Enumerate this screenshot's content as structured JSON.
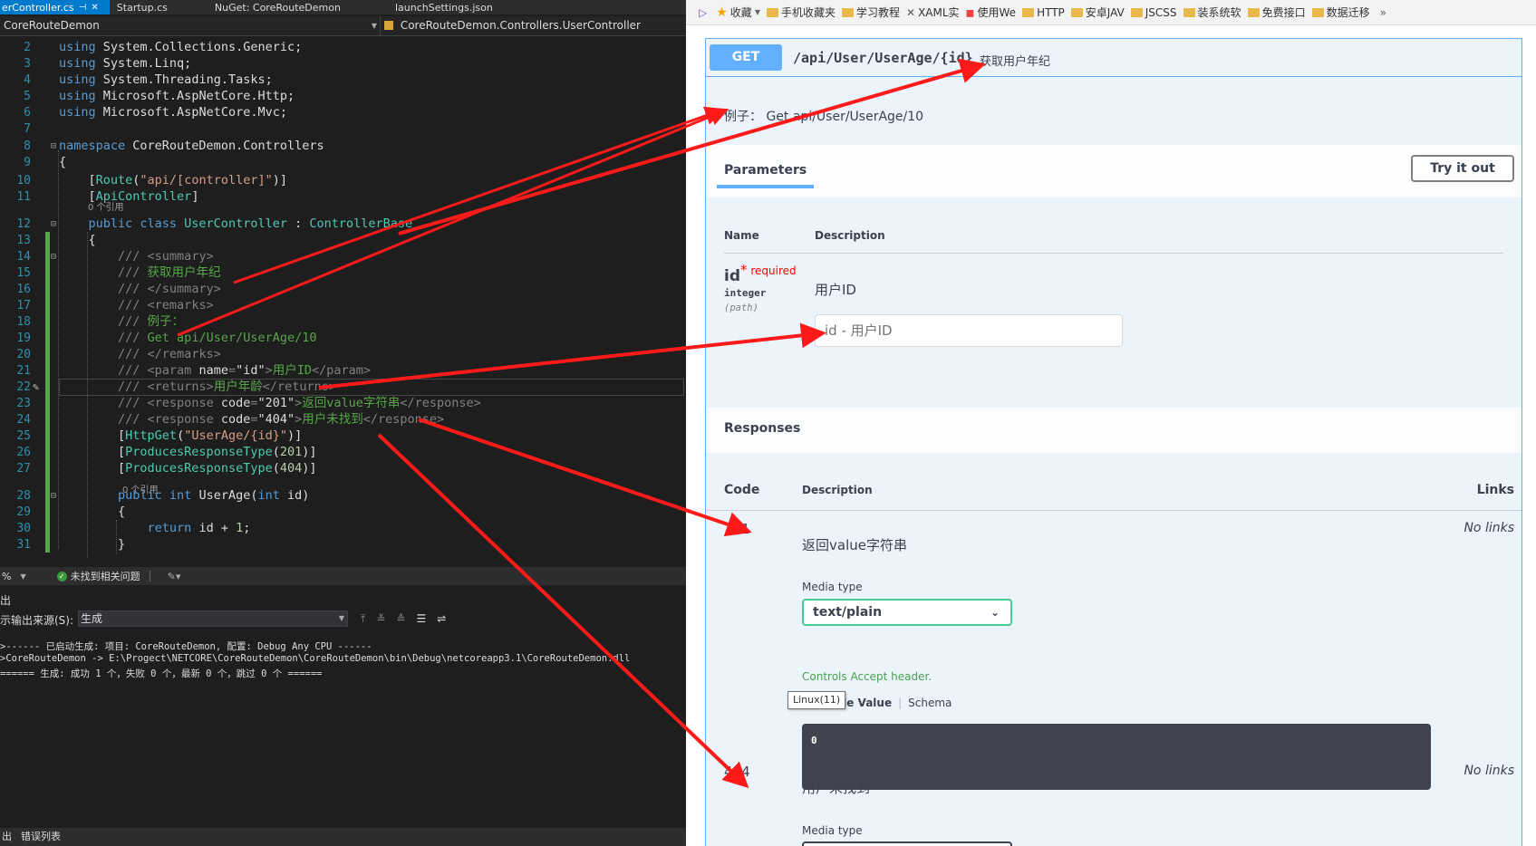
{
  "ide": {
    "tabs": [
      {
        "label": "erController.cs",
        "close": "✕",
        "pin": "⊣",
        "active": true
      },
      {
        "label": "Startup.cs"
      },
      {
        "label": "NuGet: CoreRouteDemon"
      },
      {
        "label": "launchSettings.json"
      }
    ],
    "nav": {
      "project": "CoreRouteDemon",
      "scope": "CoreRouteDemon.Controllers.UserController"
    },
    "ref_line_12": "0 个引用",
    "ref_line_28": "0 个引用",
    "status": {
      "zoom": "%",
      "issues": "未找到相关问题"
    },
    "output": {
      "title": "出",
      "source_label": "示输出来源(S):",
      "source_value": "生成",
      "lines": [
        ">------ 已启动生成: 项目: CoreRouteDemon, 配置: Debug Any CPU ------",
        ">CoreRouteDemon -> E:\\Progect\\NETCORE\\CoreRouteDemon\\CoreRouteDemon\\bin\\Debug\\netcoreapp3.1\\CoreRouteDemon.dll",
        "====== 生成: 成功 1 个，失败 0 个，最新 0 个，跳过 0 个 ======"
      ]
    },
    "bottom_tabs": [
      "出",
      "错误列表"
    ]
  },
  "browser": {
    "bookmarks": [
      "收藏",
      "手机收藏夹",
      "学习教程",
      "XAML实",
      "使用We",
      "HTTP",
      "安卓JAV",
      "JSCSS",
      "装系统软",
      "免费接口",
      "数据迁移"
    ],
    "bookmark_more": "»",
    "bookmark_lead": "▷",
    "swagger": {
      "method": "GET",
      "path": "/api/User/UserAge/{id}",
      "summary": "获取用户年纪",
      "example": "例子： Get api/User/UserAge/10",
      "parameters_tab": "Parameters",
      "try_it_out": "Try it out",
      "col_name": "Name",
      "col_description": "Description",
      "param": {
        "name": "id",
        "required_mark": "*",
        "required": "required",
        "type": "integer",
        "in": "(path)",
        "description": "用户ID",
        "placeholder": "id - 用户ID"
      },
      "responses_title": "Responses",
      "col_code": "Code",
      "col_links": "Links",
      "responses": [
        {
          "code": "201",
          "description": "返回value字符串",
          "links": "No links"
        },
        {
          "code": "404",
          "description": "用户未找到",
          "links": "No links"
        }
      ],
      "media_type_label": "Media type",
      "media_type_value": "text/plain",
      "accept_note": "Controls Accept header.",
      "example_tab": "Example Value",
      "schema_tab": "Schema",
      "example_body": "0",
      "tooltip": "Linux(11)"
    }
  },
  "colors": {
    "swagger_get": "#61affe",
    "arrow_red": "#ff1a1a",
    "vs_accent": "#007acc"
  }
}
